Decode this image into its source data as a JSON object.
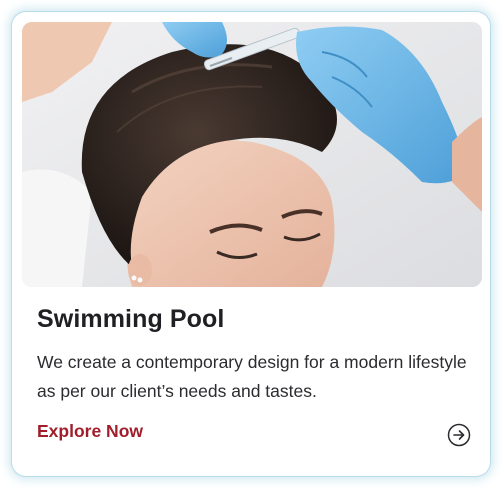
{
  "card": {
    "title": "Swimming Pool",
    "description": "We create a contemporary design for a modern lifestyle as per our client’s needs and tastes.",
    "cta_label": "Explore Now",
    "photo_alt": "Woman receiving a scalp injection treatment from gloved hands",
    "arrow_icon": "arrow-right-circle-icon"
  },
  "colors": {
    "cta": "#a01e2b",
    "title": "#1f1f24",
    "card_glow": "#8cc8dc",
    "glove": "#6cb6e8"
  }
}
